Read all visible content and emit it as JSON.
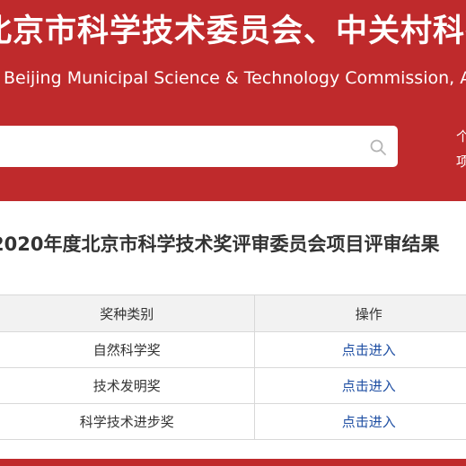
{
  "header": {
    "title_cn": "北京市科学技术委员会、中关村科技园区管理委员会",
    "title_en": "Beijing Municipal Science & Technology Commission, Administrative Commission of Zhongguancun Science Park",
    "search": {
      "placeholder": "",
      "value": ""
    },
    "side_links": [
      "个",
      "项"
    ]
  },
  "page": {
    "heading": "2020年度北京市科学技术奖评审委员会项目评审结果"
  },
  "table": {
    "headers": [
      "奖种类别",
      "操作"
    ],
    "rows": [
      {
        "category": "自然科学奖",
        "action": "点击进入"
      },
      {
        "category": "技术发明奖",
        "action": "点击进入"
      },
      {
        "category": "科学技术进步奖",
        "action": "点击进入"
      }
    ]
  },
  "colors": {
    "brand_red": "#bf2a2c",
    "link_blue": "#1f4fa3",
    "header_row_bg": "#f2f2f2"
  },
  "icons": {
    "search": "search-icon"
  }
}
